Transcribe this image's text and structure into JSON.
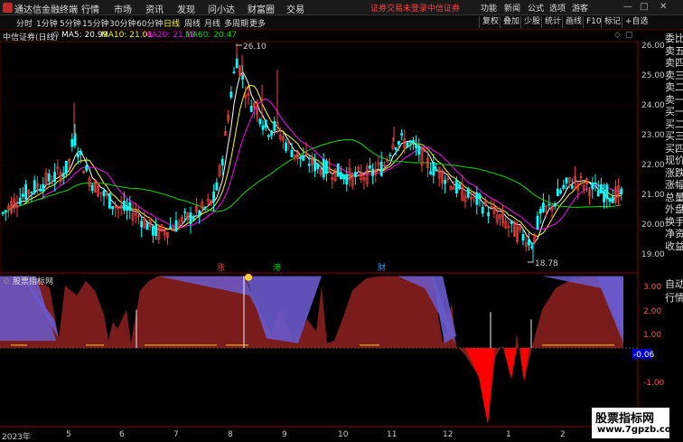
{
  "app_title": "通达信金融终端",
  "menu": [
    "行情",
    "市场",
    "资讯",
    "发现",
    "问小达",
    "财富圈",
    "交易"
  ],
  "alerts": [
    "证券交易未登录",
    "中信证券"
  ],
  "top_right": [
    "功能",
    "新闻",
    "公式",
    "选项",
    "游客"
  ],
  "periods": [
    "分时",
    "1分钟",
    "5分钟",
    "15分钟",
    "30分钟",
    "60分钟",
    "日线",
    "周线",
    "月线",
    "多周期",
    "更多"
  ],
  "active_period": "日线",
  "tools": [
    "复权",
    "叠加",
    "少股",
    "统计",
    "画线",
    "F10",
    "标记",
    "+自选"
  ],
  "stock_label": "中信证券(日线)",
  "ma": {
    "ma5": "MA5: 20.99",
    "ma10": "MA10: 21.01",
    "ma20": "MA20: 21.18",
    "ma60": "MA60: 20.47"
  },
  "colors": {
    "ma5": "#ffffff",
    "ma10": "#ffff00",
    "ma20": "#ff00ff",
    "ma60": "#00dd00",
    "up": "#ff4040",
    "down": "#00ffff"
  },
  "price_axis": [
    "26.00",
    "25.00",
    "24.00",
    "23.00",
    "22.00",
    "21.00",
    "20.00",
    "19.00"
  ],
  "high_mark": "26.10",
  "low_mark": "18.78",
  "events": [
    "涨",
    "港",
    "财"
  ],
  "indicator_title": "股票指标网",
  "indicator_axis": [
    "3.00",
    "2.00",
    "1.00",
    "-1.00"
  ],
  "indicator_current": "-0.06",
  "x_labels": [
    "2023年",
    "5",
    "6",
    "7",
    "8",
    "9",
    "10",
    "11",
    "12",
    "1",
    "2"
  ],
  "sidebar": [
    "委比",
    "卖五",
    "卖四",
    "卖三",
    "卖二",
    "卖一",
    "买一",
    "买二",
    "买三",
    "买四",
    "现价",
    "涨跌",
    "涨幅",
    "总量",
    "外盘",
    "换手",
    "净资",
    "收益",
    "自动",
    "行情"
  ],
  "watermark": {
    "line1": "股票指标网",
    "line2": "www.7gpzb.com"
  }
}
